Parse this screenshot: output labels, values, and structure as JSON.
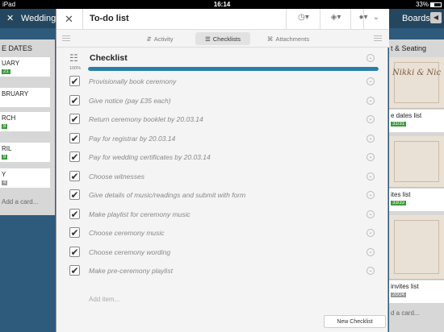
{
  "status_bar": {
    "device": "iPad",
    "time": "16:14",
    "battery": "33%"
  },
  "board": {
    "title": "Wedding",
    "boards_label": "Boards",
    "left_list": {
      "title": "E DATES",
      "cards": [
        {
          "text": "UARY",
          "badge": "21"
        },
        {
          "text": "BRUARY",
          "badge": ""
        },
        {
          "text": "RCH",
          "badge": "8"
        },
        {
          "text": "RIL",
          "badge": "8"
        },
        {
          "text": "Y",
          "badge": "4"
        }
      ],
      "add_card": "Add a card..."
    },
    "right_list": {
      "title": "t & Seating",
      "cards": [
        {
          "caption": "e dates list",
          "badge": "31/31",
          "badge_gray": false,
          "image_text": "Nikki & Nic"
        },
        {
          "caption": "ites list",
          "badge": "33/33",
          "badge_gray": false,
          "image_text": ""
        },
        {
          "caption": "invites list",
          "badge": "20/24",
          "badge_gray": true,
          "image_text": ""
        }
      ],
      "add_card": "d a card..."
    }
  },
  "modal": {
    "title": "To-do list",
    "close_icon": "close-icon",
    "header_buttons": [
      {
        "icon": "clock-icon"
      },
      {
        "icon": "tag-icon"
      },
      {
        "icon": "user-icon"
      },
      {
        "icon": "chevron-down-icon"
      }
    ],
    "tabs": [
      {
        "label": "Activity",
        "active": false
      },
      {
        "label": "Checklists",
        "active": true
      },
      {
        "label": "Attachments",
        "active": false
      }
    ],
    "checklist": {
      "name": "Checklist",
      "progress_label": "100%",
      "progress": 1.0,
      "items": [
        {
          "text": "Provisionally book ceremony",
          "checked": true
        },
        {
          "text": "Give notice (pay £35 each)",
          "checked": true
        },
        {
          "text": "Return ceremony booklet by 20.03.14",
          "checked": true
        },
        {
          "text": "Pay for registrar by 20.03.14",
          "checked": true
        },
        {
          "text": "Pay for wedding certificates by 20.03.14",
          "checked": true
        },
        {
          "text": "Choose witnesses",
          "checked": true
        },
        {
          "text": "Give details of music/readings and submit with form",
          "checked": true
        },
        {
          "text": "Make playlist for ceremony music",
          "checked": true
        },
        {
          "text": "Choose ceremony music",
          "checked": true
        },
        {
          "text": "Choose ceremony wording",
          "checked": true
        },
        {
          "text": "Make pre-ceremony playlist",
          "checked": true
        }
      ],
      "add_item_placeholder": "Add item..."
    },
    "new_checklist_label": "New Checklist"
  },
  "colors": {
    "progress": "#2a7fa8",
    "board_bg": "#2e5a7c",
    "badge_green": "#3c9a3c"
  }
}
